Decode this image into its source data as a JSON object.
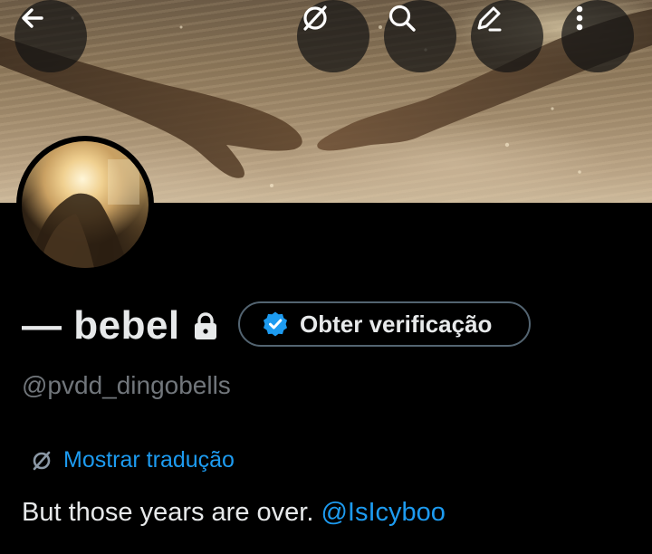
{
  "header": {
    "back_icon": "arrow-left-icon",
    "translate_icon": "translate-icon",
    "search_icon": "search-icon",
    "edit_icon": "edit-pencil-icon",
    "more_icon": "more-vertical-icon"
  },
  "profile": {
    "display_name": "— bebel",
    "protected_icon": "lock-icon",
    "verify_button_label": "Obter verificação",
    "verify_icon": "verified-badge-icon",
    "handle": "@pvdd_dingobells",
    "translate_label": "Mostrar tradução",
    "bio_text": "But those years are over. ",
    "bio_mention": "@IsIcyboo"
  },
  "colors": {
    "background": "#000000",
    "text_primary": "#e7e9ea",
    "text_secondary": "#71767b",
    "accent": "#1d9bf0",
    "border": "#536471"
  }
}
